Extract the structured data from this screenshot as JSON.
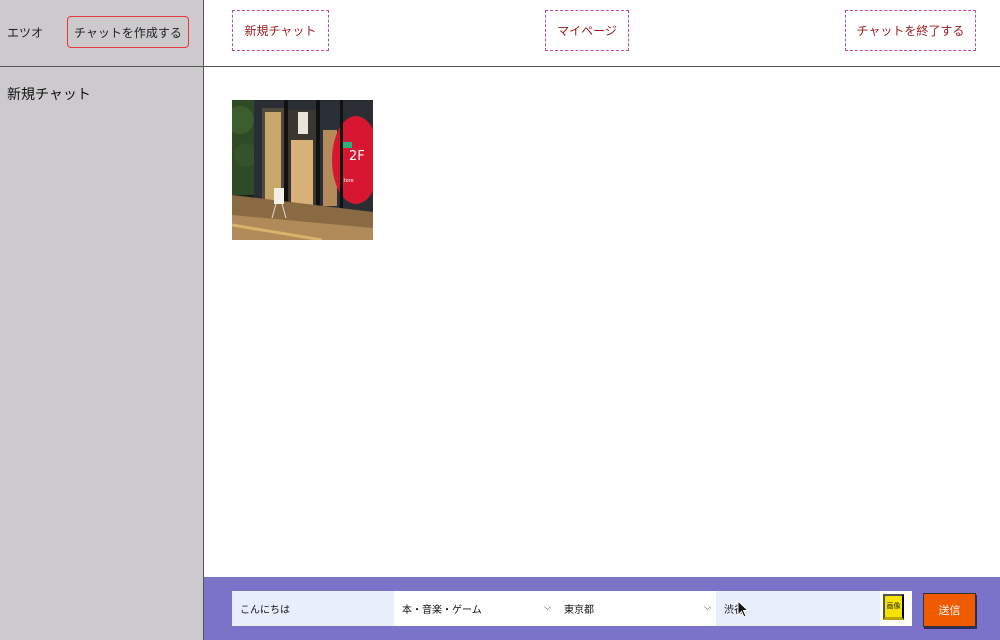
{
  "sidebar": {
    "username": "エツオ",
    "create_button_label": "チャットを作成する",
    "chats": [
      {
        "label": "新規チャット"
      }
    ]
  },
  "header": {
    "new_chat_label": "新規チャット",
    "mypage_label": "マイページ",
    "end_chat_label": "チャットを終了する"
  },
  "messages": {
    "image_description_icon": "storefront-photo"
  },
  "composer": {
    "text_value": "こんにちは",
    "genre_selected": "本・音楽・ゲーム",
    "prefecture_selected": "東京都",
    "area_value": "渋谷",
    "image_button_label": "画像",
    "send_button_label": "送信"
  },
  "colors": {
    "sidebar_bg": "#cccacd",
    "input_bar_bg": "#7a73c9",
    "send_button": "#f05a00",
    "image_button": "#f6e400",
    "header_button_text": "#9b1a1a"
  }
}
